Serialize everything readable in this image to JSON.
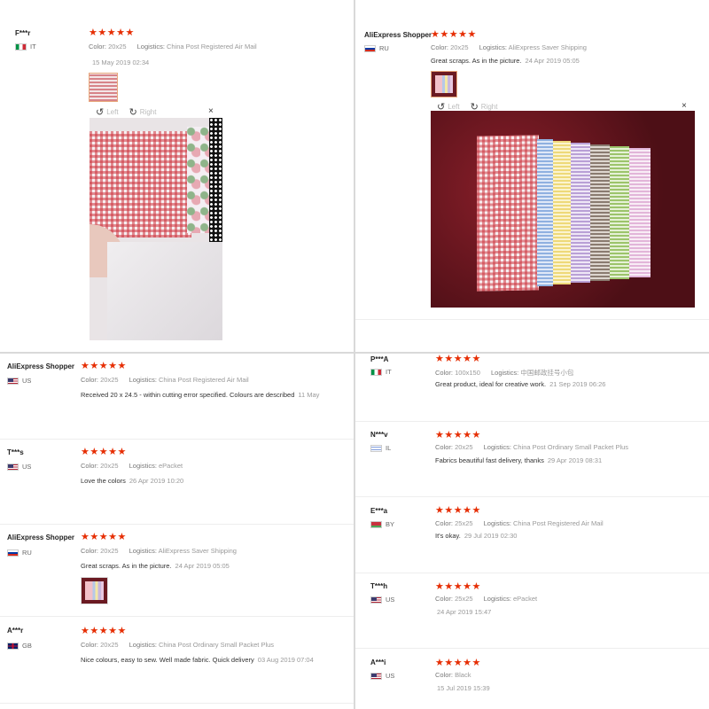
{
  "reviews": {
    "r1": {
      "user": "F***r",
      "country": "IT",
      "color_label": "Color:",
      "color": "20x25",
      "logistics_label": "Logistics:",
      "logistics": "China Post Registered Air Mail",
      "date": "15 May 2019 02:34"
    },
    "r2": {
      "user": "AliExpress Shopper",
      "country": "RU",
      "color_label": "Color:",
      "color": "20x25",
      "logistics_label": "Logistics:",
      "logistics": "AliExpress Saver Shipping",
      "text": "Great scraps. As in the picture.",
      "date": "24 Apr 2019 05:05"
    },
    "r3": {
      "user": "AliExpress Shopper",
      "country": "US",
      "color_label": "Color:",
      "color": "20x25",
      "logistics_label": "Logistics:",
      "logistics": "China Post Registered Air Mail",
      "text": "Received 20 x 24.5 - within cutting error specified. Colours are described",
      "date": "11 May"
    },
    "r4": {
      "user": "T***s",
      "country": "US",
      "color_label": "Color:",
      "color": "20x25",
      "logistics_label": "Logistics:",
      "logistics": "ePacket",
      "text": "Love the colors",
      "date": "26 Apr 2019 10:20"
    },
    "r5": {
      "user": "AliExpress Shopper",
      "country": "RU",
      "color_label": "Color:",
      "color": "20x25",
      "logistics_label": "Logistics:",
      "logistics": "AliExpress Saver Shipping",
      "text": "Great scraps. As in the picture.",
      "date": "24 Apr 2019 05:05"
    },
    "r6": {
      "user": "A***r",
      "country": "GB",
      "color_label": "Color:",
      "color": "20x25",
      "logistics_label": "Logistics:",
      "logistics": "China Post Ordinary Small Packet Plus",
      "text": "Nice colours, easy to sew. Well made fabric. Quick delivery",
      "date": "03 Aug 2019 07:04"
    },
    "r7": {
      "user": "P***A",
      "country": "IT",
      "color_label": "Color:",
      "color": "100x150",
      "logistics_label": "Logistics:",
      "logistics": "中国邮政挂号小包",
      "text": "Great product, ideal for creative work.",
      "date": "21 Sep 2019 06:26"
    },
    "r8": {
      "user": "N***v",
      "country": "IL",
      "color_label": "Color:",
      "color": "20x25",
      "logistics_label": "Logistics:",
      "logistics": "China Post Ordinary Small Packet Plus",
      "text": "Fabrics beautiful fast delivery, thanks",
      "date": "29 Apr 2019 08:31"
    },
    "r9": {
      "user": "E***a",
      "country": "BY",
      "color_label": "Color:",
      "color": "25x25",
      "logistics_label": "Logistics:",
      "logistics": "China Post Registered Air Mail",
      "text": "It's okay.",
      "date": "29 Jul 2019 02:30"
    },
    "r10": {
      "user": "T***h",
      "country": "US",
      "color_label": "Color:",
      "color": "25x25",
      "logistics_label": "Logistics:",
      "logistics": "ePacket",
      "date": "24 Apr 2019 15:47"
    },
    "r11": {
      "user": "A***i",
      "country": "US",
      "color_label": "Color:",
      "color": "Black",
      "date": "15 Jul 2019 15:39"
    }
  },
  "rating_stars": "★★★★★",
  "viewer": {
    "left_label": "Left",
    "right_label": "Right",
    "close": "×",
    "rotate_left_icon": "↺",
    "rotate_right_icon": "↻"
  },
  "colors": {
    "star": "#e62e04",
    "thumb_border": "#e8a87c"
  }
}
